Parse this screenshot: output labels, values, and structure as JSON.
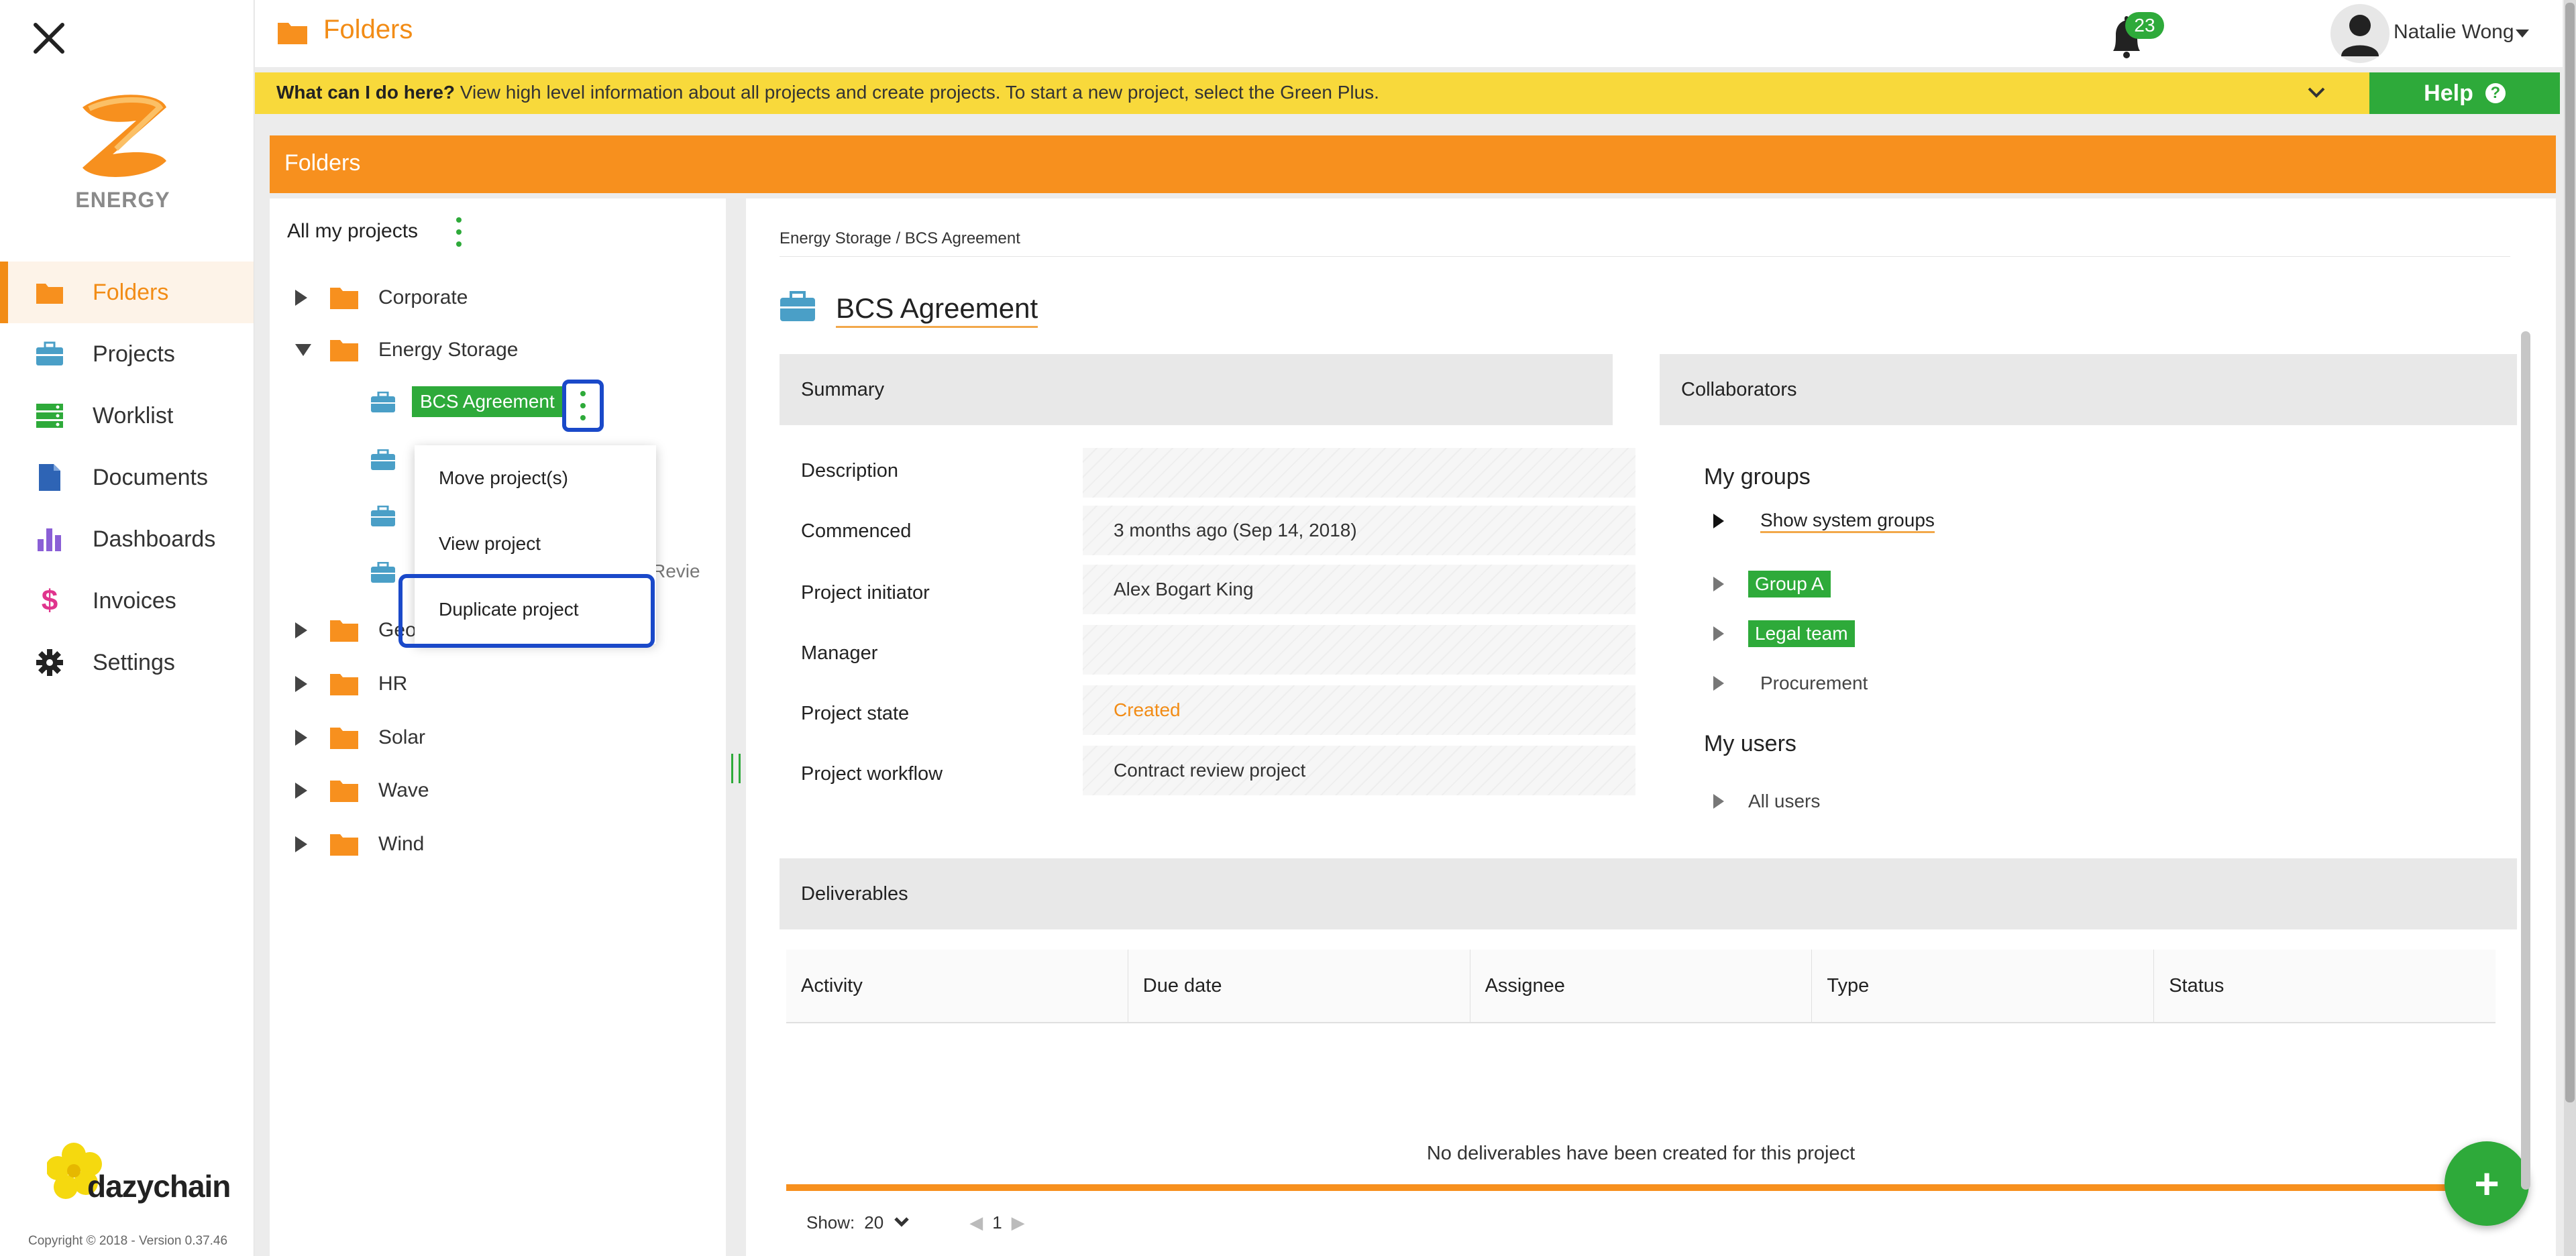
{
  "app": {
    "brand_text": "ENERGY",
    "vendor_text": "dazychain",
    "copyright": "Copyright © 2018 - Version 0.37.46",
    "accent_color": "#f7901e",
    "green_color": "#2eaa3a",
    "highlight_color": "#1a49c9"
  },
  "topbar": {
    "title": "Folders",
    "notifications": "23",
    "user": "Natalie Wong"
  },
  "banner": {
    "lead": "What can I do here?",
    "text": " View high level information about all projects and create projects. To start a new project, select the Green Plus.",
    "help_label": "Help",
    "help_icon": "?"
  },
  "nav": {
    "items": [
      {
        "label": "Folders",
        "icon": "folder-icon"
      },
      {
        "label": "Projects",
        "icon": "briefcase-icon"
      },
      {
        "label": "Worklist",
        "icon": "worklist-icon"
      },
      {
        "label": "Documents",
        "icon": "document-icon"
      },
      {
        "label": "Dashboards",
        "icon": "bar-chart-icon"
      },
      {
        "label": "Invoices",
        "icon": "dollar-icon"
      },
      {
        "label": "Settings",
        "icon": "gear-icon"
      }
    ]
  },
  "folders": {
    "header": "Folders",
    "all_projects": "All my projects",
    "tree": [
      {
        "label": "Corporate"
      },
      {
        "label": "Energy Storage"
      },
      {
        "label": "Geo"
      },
      {
        "label": "HR"
      },
      {
        "label": "Solar"
      },
      {
        "label": "Wave"
      },
      {
        "label": "Wind"
      }
    ],
    "selected_project": "BCS Agreement",
    "partial_label": "Revie",
    "context_menu": [
      "Move project(s)",
      "View project",
      "Duplicate project"
    ]
  },
  "project": {
    "breadcrumb": "Energy Storage / BCS Agreement",
    "title": "BCS Agreement",
    "summary_header": "Summary",
    "fields": [
      {
        "label": "Description",
        "value": ""
      },
      {
        "label": "Commenced",
        "value": "3 months ago (Sep 14, 2018)"
      },
      {
        "label": "Project initiator",
        "value": "Alex Bogart King"
      },
      {
        "label": "Manager",
        "value": ""
      },
      {
        "label": "Project state",
        "value": "Created"
      },
      {
        "label": "Project workflow",
        "value": "Contract review project"
      }
    ],
    "collaborators_header": "Collaborators",
    "my_groups": "My groups",
    "show_system_groups": "Show system groups",
    "groups": [
      "Group A",
      "Legal team",
      "Procurement"
    ],
    "my_users": "My users",
    "all_users": "All users",
    "deliverables_header": "Deliverables",
    "columns": [
      "Activity",
      "Due date",
      "Assignee",
      "Type",
      "Status"
    ],
    "empty_message": "No deliverables have been created for this project",
    "show_label": "Show:",
    "page_size": "20",
    "page": "1"
  }
}
